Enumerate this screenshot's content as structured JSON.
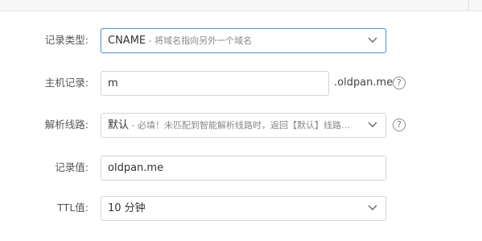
{
  "form": {
    "record_type": {
      "label": "记录类型:",
      "value_main": "CNAME",
      "value_hint": " - 将域名指向另外一个域名"
    },
    "host_record": {
      "label": "主机记录:",
      "value": "m",
      "suffix": ".oldpan.me",
      "help": "?"
    },
    "resolve_line": {
      "label": "解析线路:",
      "value_main": "默认",
      "value_hint": " - 必填！未匹配到智能解析线路时，返回【默认】线路…",
      "help": "?"
    },
    "record_value": {
      "label": "记录值:",
      "value": "oldpan.me"
    },
    "ttl": {
      "label": "TTL值:",
      "value": "10 分钟"
    }
  }
}
